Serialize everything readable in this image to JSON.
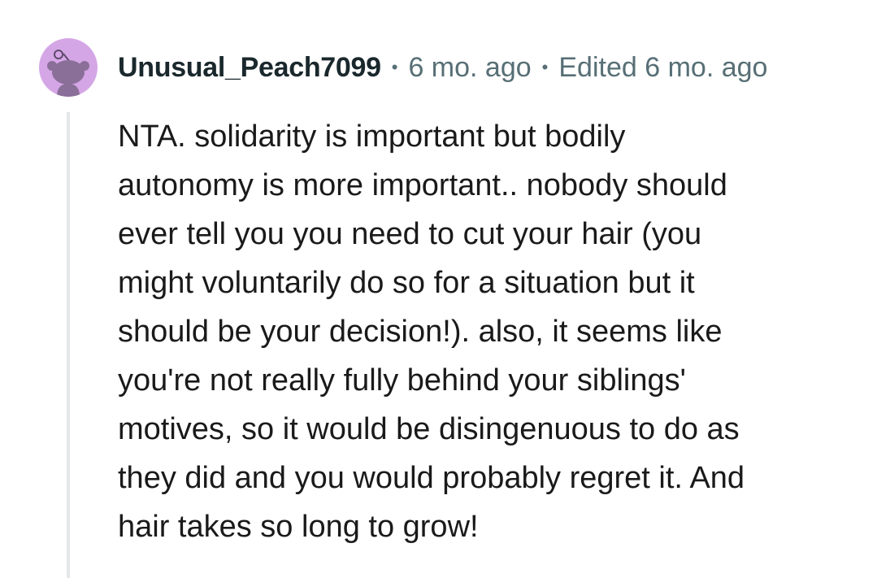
{
  "comment": {
    "author": "Unusual_Peach7099",
    "separator": "•",
    "posted": "6 mo. ago",
    "edited": "Edited 6 mo. ago",
    "avatar_icon": "snoo-avatar-icon",
    "avatar_color": "#d5a6e6",
    "body_lines": [
      "NTA. solidarity is important but bodily",
      "autonomy is more important.. nobody should",
      "ever tell you you need to cut your hair (you",
      "might voluntarily do so for a situation but it",
      "should be your decision!). also, it seems like",
      "you're not really fully behind your siblings'",
      "motives, so it would be disingenuous to do as",
      "they did and you would probably regret it. And",
      "hair takes so long to grow!"
    ]
  }
}
